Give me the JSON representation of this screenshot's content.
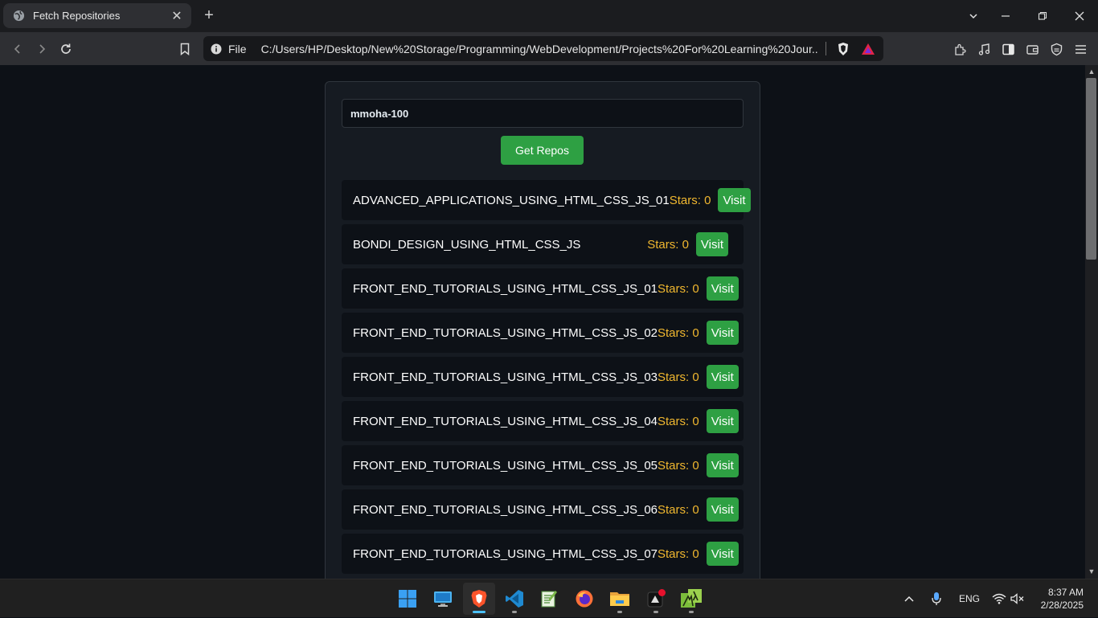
{
  "browser": {
    "tab_title": "Fetch Repositories",
    "url_scheme": "File",
    "url": "C:/Users/HP/Desktop/New%20Storage/Programming/WebDevelopment/Projects%20For%20Learning%20Jour..."
  },
  "app": {
    "search_value": "mmoha-100",
    "button_label": "Get Repos",
    "visit_label": "Visit",
    "repos": [
      {
        "name": "ADVANCED_APPLICATIONS_USING_HTML_CSS_JS_01",
        "stars": "Stars: 0"
      },
      {
        "name": "BONDI_DESIGN_USING_HTML_CSS_JS",
        "stars": "Stars: 0"
      },
      {
        "name": "FRONT_END_TUTORIALS_USING_HTML_CSS_JS_01",
        "stars": "Stars: 0"
      },
      {
        "name": "FRONT_END_TUTORIALS_USING_HTML_CSS_JS_02",
        "stars": "Stars: 0"
      },
      {
        "name": "FRONT_END_TUTORIALS_USING_HTML_CSS_JS_03",
        "stars": "Stars: 0"
      },
      {
        "name": "FRONT_END_TUTORIALS_USING_HTML_CSS_JS_04",
        "stars": "Stars: 0"
      },
      {
        "name": "FRONT_END_TUTORIALS_USING_HTML_CSS_JS_05",
        "stars": "Stars: 0"
      },
      {
        "name": "FRONT_END_TUTORIALS_USING_HTML_CSS_JS_06",
        "stars": "Stars: 0"
      },
      {
        "name": "FRONT_END_TUTORIALS_USING_HTML_CSS_JS_07",
        "stars": "Stars: 0"
      }
    ]
  },
  "taskbar": {
    "language": "ENG",
    "time": "8:37 AM",
    "date": "2/28/2025"
  },
  "colors": {
    "accent_green": "#2ea043",
    "stars_yellow": "#f0b72f",
    "page_bg": "#0d1117",
    "card_bg": "#161b22"
  }
}
